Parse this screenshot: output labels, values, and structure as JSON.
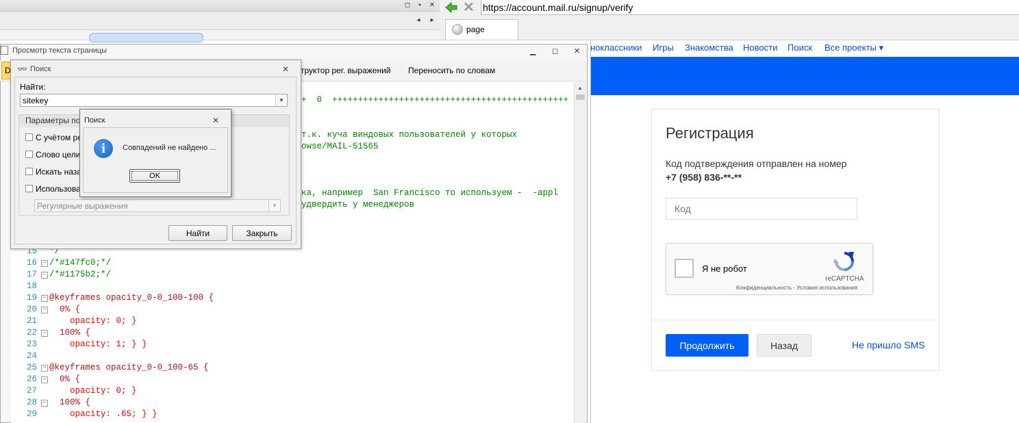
{
  "browser": {
    "url": "https://account.mail.ru/signup/verify",
    "tab_title": "page",
    "nav": [
      "ноклассники",
      "Игры",
      "Знакомства",
      "Новости",
      "Поиск",
      "Все проекты ▾"
    ]
  },
  "registration": {
    "title": "Регистрация",
    "sent_text": "Код подтверждения отправлен на номер",
    "phone": "+7 (958) 836-**-**",
    "code_placeholder": "Код",
    "captcha_label": "Я не робот",
    "captcha_brand": "reCAPTCHA",
    "captcha_links": "Конфиденциальность - Условия использования",
    "continue_button": "Продолжить",
    "back_button": "Назад",
    "no_sms_link": "Не пришло SMS"
  },
  "viewer": {
    "title": "Просмотр текста страницы",
    "toolbar_left": "D",
    "toolbar": [
      "труктор рег. выражений",
      "Переносить по словам"
    ]
  },
  "code": {
    "fragments": [
      "+  0  ++++++++++++++++++++++++++++++++++++++++++++++",
      "т.к. куча виндовых пользователей у которых",
      "owse/MAIL-51565",
      "ка, например  San Francisco то используем -  -appl",
      "удвердить у менеджеров"
    ],
    "lines": [
      {
        "n": "15",
        "t": "*/"
      },
      {
        "n": "16",
        "t": "/*#147fc0;*/"
      },
      {
        "n": "17",
        "t": "/*#1175b2;*/"
      },
      {
        "n": "18",
        "t": ""
      },
      {
        "n": "19",
        "t": "@keyframes opacity_0-0_100-100 {"
      },
      {
        "n": "20",
        "t": "  0% {"
      },
      {
        "n": "21",
        "t": "    opacity: 0; }"
      },
      {
        "n": "22",
        "t": "  100% {"
      },
      {
        "n": "23",
        "t": "    opacity: 1; } }"
      },
      {
        "n": "24",
        "t": ""
      },
      {
        "n": "25",
        "t": "@keyframes opacity_0-0_100-65 {"
      },
      {
        "n": "26",
        "t": "  0% {"
      },
      {
        "n": "27",
        "t": "    opacity: 0; }"
      },
      {
        "n": "28",
        "t": "  100% {"
      },
      {
        "n": "29",
        "t": "    opacity: .65; } }"
      }
    ]
  },
  "search_dialog": {
    "title": "Поиск",
    "find_label": "Найти:",
    "find_value": "sitekey",
    "group_title": "Параметры пои",
    "options": [
      "С учётом рег",
      "Слово целик",
      "Искать назад",
      "Использоват"
    ],
    "regex_value": "Регулярные выражения",
    "find_button": "Найти",
    "close_button": "Закрыть"
  },
  "alert": {
    "title": "Поиск",
    "message": "Совпадений не найдено ...",
    "ok_button": "OK"
  },
  "colors": {
    "mail_blue": "#005ff9",
    "link": "#0d4cd3",
    "comment": "#008000"
  }
}
